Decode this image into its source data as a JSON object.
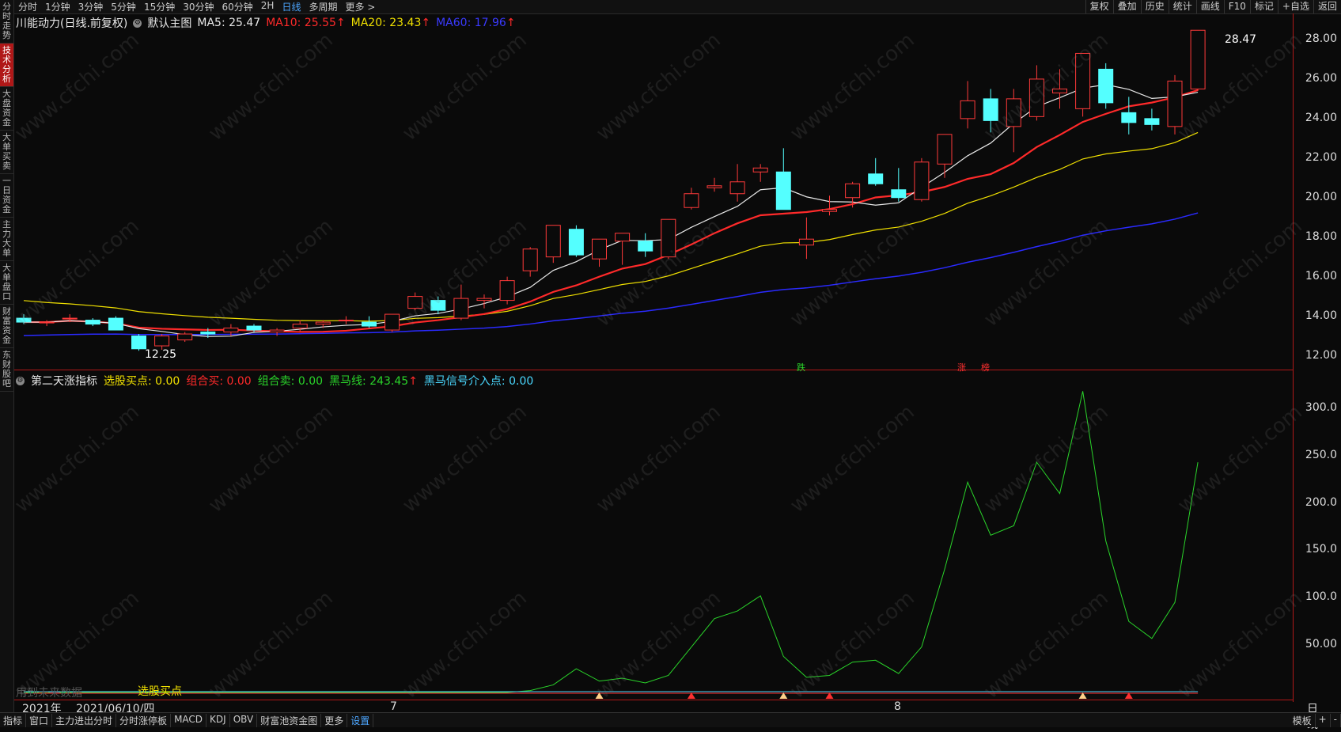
{
  "sidebar": {
    "items": [
      "分时走势",
      "技术分析",
      "大盘资金",
      "大单买卖",
      "一日资金",
      "主力大单",
      "大单盘口",
      "财富资金",
      "东财股吧"
    ],
    "active_index": 1
  },
  "topbar": {
    "periods": [
      "分时",
      "1分钟",
      "3分钟",
      "5分钟",
      "15分钟",
      "30分钟",
      "60分钟",
      "2H",
      "日线",
      "多周期",
      "更多 >"
    ],
    "active_period": "日线",
    "right_buttons": [
      "复权",
      "叠加",
      "历史",
      "统计",
      "画线",
      "F10",
      "标记",
      "+自选",
      "返回"
    ]
  },
  "main_legend": {
    "stock": "川能动力(日线.前复权)",
    "template": "默认主图",
    "ma5": "MA5: 25.47",
    "ma10": "MA10: 25.55",
    "ma20": "MA20: 23.43",
    "ma60": "MA60: 17.96",
    "ma5_color": "#e8e8e8",
    "ma10_color": "#ff2a2a",
    "ma20_color": "#f0e000",
    "ma60_color": "#2a2aff"
  },
  "indicator_legend": {
    "name": "第二天涨指标",
    "buy_point": "选股买点: 0.00",
    "combo_buy": "组合买: 0.00",
    "combo_sell": "组合卖: 0.00",
    "dark_horse": "黑马线: 243.45",
    "dark_horse_entry": "黑马信号介入点: 0.00"
  },
  "price_axis": [
    "28.00",
    "26.00",
    "24.00",
    "22.00",
    "20.00",
    "18.00",
    "16.00",
    "14.00",
    "12.00"
  ],
  "indicator_axis": [
    "300.0",
    "250.0",
    "200.0",
    "150.0",
    "100.0",
    "50.00"
  ],
  "annotations": {
    "high": "28.47",
    "low": "12.25",
    "mark_fall": "跌",
    "mark_rise": "涨",
    "mark_limit": "榜",
    "future_data": "用到未来数据",
    "buy_label": "选股买点"
  },
  "dates": {
    "year": "2021年",
    "current": "2021/06/10/四",
    "month7": "7",
    "month8": "8",
    "period_label": "日线"
  },
  "bottom_tabs": [
    "指标",
    "窗口",
    "主力进出分时",
    "分时涨停板",
    "MACD",
    "KDJ",
    "OBV",
    "财富池资金图",
    "更多",
    "设置"
  ],
  "bottom_active": "设置",
  "bottom_right": [
    "模板",
    "+",
    "-"
  ],
  "watermark": "www.cfchi.com",
  "chart_data": {
    "type": "candlestick",
    "price_ylim": [
      11.5,
      29.0
    ],
    "candles": [
      [
        13.9,
        14.1,
        13.6,
        13.7
      ],
      [
        13.7,
        13.8,
        13.5,
        13.7
      ],
      [
        13.9,
        14.1,
        13.7,
        13.9
      ],
      [
        13.8,
        13.9,
        13.5,
        13.6
      ],
      [
        13.9,
        14.0,
        13.3,
        13.3
      ],
      [
        13.0,
        13.1,
        12.25,
        12.35
      ],
      [
        12.5,
        13.1,
        12.3,
        13.0
      ],
      [
        12.8,
        13.2,
        12.7,
        13.1
      ],
      [
        13.2,
        13.4,
        12.9,
        13.1
      ],
      [
        13.2,
        13.6,
        13.0,
        13.4
      ],
      [
        13.5,
        13.6,
        13.2,
        13.3
      ],
      [
        13.2,
        13.4,
        13.0,
        13.3
      ],
      [
        13.4,
        13.8,
        13.2,
        13.6
      ],
      [
        13.6,
        13.8,
        13.4,
        13.7
      ],
      [
        13.8,
        14.0,
        13.6,
        13.8
      ],
      [
        13.7,
        14.0,
        13.4,
        13.5
      ],
      [
        13.3,
        14.1,
        13.2,
        14.1
      ],
      [
        14.4,
        15.2,
        14.3,
        15.0
      ],
      [
        14.8,
        15.0,
        14.1,
        14.3
      ],
      [
        13.9,
        15.6,
        13.8,
        14.9
      ],
      [
        14.8,
        15.1,
        14.4,
        14.9
      ],
      [
        14.8,
        16.0,
        14.6,
        15.8
      ],
      [
        16.3,
        17.5,
        16.0,
        17.4
      ],
      [
        17.0,
        18.5,
        16.7,
        18.6
      ],
      [
        18.4,
        18.6,
        17.0,
        17.1
      ],
      [
        16.9,
        17.9,
        16.5,
        17.9
      ],
      [
        17.8,
        18.1,
        16.6,
        18.2
      ],
      [
        17.8,
        18.2,
        17.0,
        17.3
      ],
      [
        17.0,
        18.9,
        16.9,
        18.9
      ],
      [
        19.5,
        20.5,
        19.4,
        20.2
      ],
      [
        20.5,
        21.0,
        20.3,
        20.6
      ],
      [
        20.2,
        21.7,
        19.8,
        20.8
      ],
      [
        21.3,
        21.7,
        20.8,
        21.5
      ],
      [
        21.3,
        22.5,
        19.5,
        19.4
      ],
      [
        17.6,
        19.0,
        16.9,
        17.9
      ],
      [
        19.3,
        20.1,
        19.1,
        19.4
      ],
      [
        20.0,
        20.8,
        19.5,
        20.7
      ],
      [
        21.2,
        22.0,
        20.6,
        20.7
      ],
      [
        20.4,
        21.5,
        19.8,
        20.0
      ],
      [
        19.9,
        22.0,
        19.8,
        21.8
      ],
      [
        21.7,
        23.1,
        21.0,
        23.2
      ],
      [
        24.0,
        25.9,
        23.5,
        24.9
      ],
      [
        25.0,
        25.5,
        23.3,
        23.9
      ],
      [
        23.6,
        25.5,
        22.3,
        25.0
      ],
      [
        24.1,
        26.7,
        23.9,
        26.0
      ],
      [
        25.3,
        26.5,
        24.5,
        25.5
      ],
      [
        24.5,
        26.5,
        24.1,
        27.3
      ],
      [
        26.5,
        26.8,
        24.5,
        24.8
      ],
      [
        24.3,
        25.1,
        23.2,
        23.8
      ],
      [
        24.0,
        24.5,
        23.4,
        23.7
      ],
      [
        23.6,
        26.2,
        23.2,
        25.9
      ],
      [
        25.5,
        28.3,
        25.4,
        28.47
      ]
    ],
    "indicator_ylim": [
      0,
      330
    ],
    "dark_horse_line": [
      0,
      0,
      0,
      0,
      0,
      0,
      0,
      0,
      0,
      0,
      0,
      0,
      0,
      0,
      0,
      0,
      0,
      0,
      0,
      0,
      0,
      0,
      2,
      8,
      25,
      12,
      15,
      10,
      18,
      48,
      78,
      86,
      102,
      38,
      16,
      18,
      32,
      34,
      20,
      48,
      130,
      222,
      166,
      176,
      243,
      210,
      318,
      160,
      75,
      57,
      95,
      243
    ]
  }
}
